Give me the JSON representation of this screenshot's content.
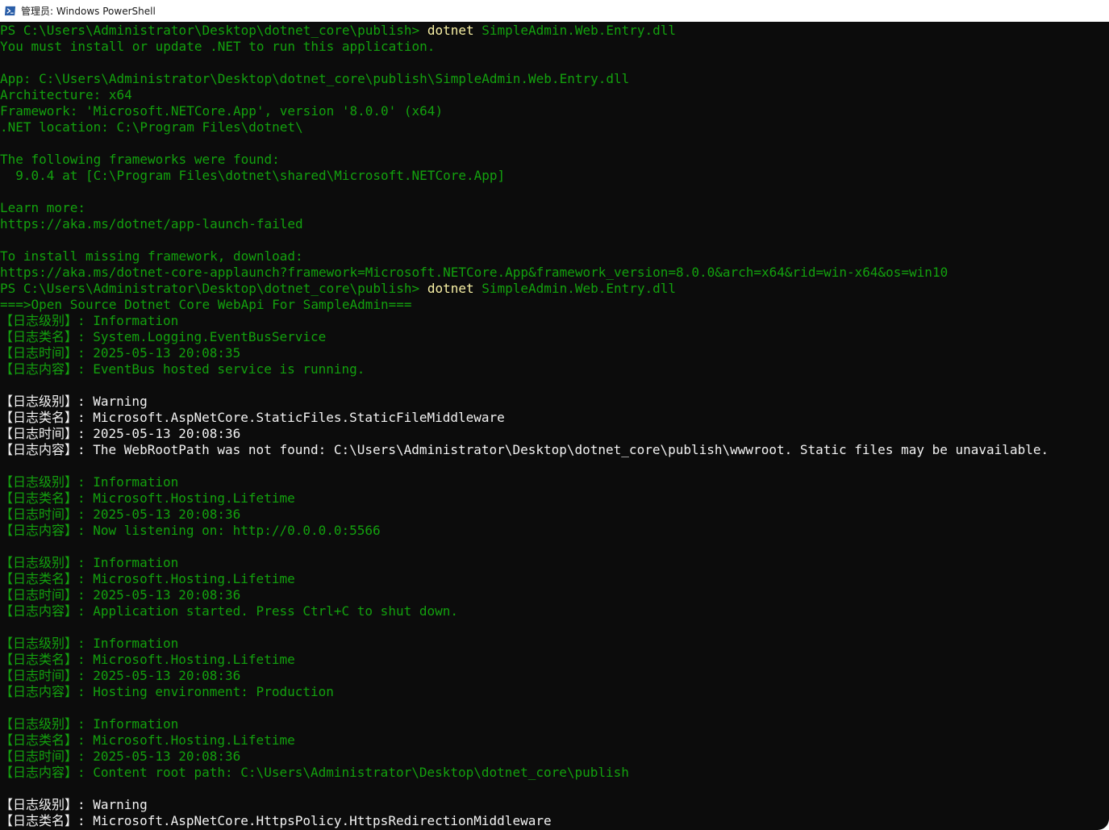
{
  "window": {
    "title": "管理员: Windows PowerShell",
    "icon": "powershell-icon"
  },
  "colors": {
    "background": "#0c0c0c",
    "green": "#13a10e",
    "white": "#f2f2f2",
    "command_yellow": "#f9f1a5",
    "title_bar": "#ffffff"
  },
  "console": {
    "lines": [
      {
        "color": "green",
        "parts": [
          {
            "t": "PS C:\\Users\\Administrator\\Desktop\\dotnet_core\\publish> "
          },
          {
            "t": "dotnet",
            "c": "cmd-kw"
          },
          {
            "t": " SimpleAdmin.Web.Entry.dll"
          }
        ]
      },
      {
        "color": "green",
        "parts": [
          {
            "t": "You must install or update .NET to run this application."
          }
        ]
      },
      {
        "color": "green",
        "parts": [
          {
            "t": ""
          }
        ]
      },
      {
        "color": "green",
        "parts": [
          {
            "t": "App: C:\\Users\\Administrator\\Desktop\\dotnet_core\\publish\\SimpleAdmin.Web.Entry.dll"
          }
        ]
      },
      {
        "color": "green",
        "parts": [
          {
            "t": "Architecture: x64"
          }
        ]
      },
      {
        "color": "green",
        "parts": [
          {
            "t": "Framework: 'Microsoft.NETCore.App', version '8.0.0' (x64)"
          }
        ]
      },
      {
        "color": "green",
        "parts": [
          {
            "t": ".NET location: C:\\Program Files\\dotnet\\"
          }
        ]
      },
      {
        "color": "green",
        "parts": [
          {
            "t": ""
          }
        ]
      },
      {
        "color": "green",
        "parts": [
          {
            "t": "The following frameworks were found:"
          }
        ]
      },
      {
        "color": "green",
        "parts": [
          {
            "t": "  9.0.4 at [C:\\Program Files\\dotnet\\shared\\Microsoft.NETCore.App]"
          }
        ]
      },
      {
        "color": "green",
        "parts": [
          {
            "t": ""
          }
        ]
      },
      {
        "color": "green",
        "parts": [
          {
            "t": "Learn more:"
          }
        ]
      },
      {
        "color": "green",
        "parts": [
          {
            "t": "https://aka.ms/dotnet/app-launch-failed"
          }
        ]
      },
      {
        "color": "green",
        "parts": [
          {
            "t": ""
          }
        ]
      },
      {
        "color": "green",
        "parts": [
          {
            "t": "To install missing framework, download:"
          }
        ]
      },
      {
        "color": "green",
        "parts": [
          {
            "t": "https://aka.ms/dotnet-core-applaunch?framework=Microsoft.NETCore.App&framework_version=8.0.0&arch=x64&rid=win-x64&os=win10"
          }
        ]
      },
      {
        "color": "green",
        "parts": [
          {
            "t": "PS C:\\Users\\Administrator\\Desktop\\dotnet_core\\publish> "
          },
          {
            "t": "dotnet",
            "c": "cmd-kw"
          },
          {
            "t": " SimpleAdmin.Web.Entry.dll"
          }
        ]
      },
      {
        "color": "green",
        "parts": [
          {
            "t": "===>Open Source Dotnet Core WebApi For SampleAdmin==="
          }
        ]
      },
      {
        "color": "green",
        "parts": [
          {
            "t": "【日志级别】: Information"
          }
        ]
      },
      {
        "color": "green",
        "parts": [
          {
            "t": "【日志类名】: System.Logging.EventBusService"
          }
        ]
      },
      {
        "color": "green",
        "parts": [
          {
            "t": "【日志时间】: 2025-05-13 20:08:35"
          }
        ]
      },
      {
        "color": "green",
        "parts": [
          {
            "t": "【日志内容】: EventBus hosted service is running."
          }
        ]
      },
      {
        "color": "green",
        "parts": [
          {
            "t": ""
          }
        ]
      },
      {
        "color": "white",
        "parts": [
          {
            "t": "【日志级别】: Warning"
          }
        ]
      },
      {
        "color": "white",
        "parts": [
          {
            "t": "【日志类名】: Microsoft.AspNetCore.StaticFiles.StaticFileMiddleware"
          }
        ]
      },
      {
        "color": "white",
        "parts": [
          {
            "t": "【日志时间】: 2025-05-13 20:08:36"
          }
        ]
      },
      {
        "color": "white",
        "parts": [
          {
            "t": "【日志内容】: The WebRootPath was not found: C:\\Users\\Administrator\\Desktop\\dotnet_core\\publish\\wwwroot. Static files may be unavailable."
          }
        ]
      },
      {
        "color": "green",
        "parts": [
          {
            "t": ""
          }
        ]
      },
      {
        "color": "green",
        "parts": [
          {
            "t": "【日志级别】: Information"
          }
        ]
      },
      {
        "color": "green",
        "parts": [
          {
            "t": "【日志类名】: Microsoft.Hosting.Lifetime"
          }
        ]
      },
      {
        "color": "green",
        "parts": [
          {
            "t": "【日志时间】: 2025-05-13 20:08:36"
          }
        ]
      },
      {
        "color": "green",
        "parts": [
          {
            "t": "【日志内容】: Now listening on: http://0.0.0.0:5566"
          }
        ]
      },
      {
        "color": "green",
        "parts": [
          {
            "t": ""
          }
        ]
      },
      {
        "color": "green",
        "parts": [
          {
            "t": "【日志级别】: Information"
          }
        ]
      },
      {
        "color": "green",
        "parts": [
          {
            "t": "【日志类名】: Microsoft.Hosting.Lifetime"
          }
        ]
      },
      {
        "color": "green",
        "parts": [
          {
            "t": "【日志时间】: 2025-05-13 20:08:36"
          }
        ]
      },
      {
        "color": "green",
        "parts": [
          {
            "t": "【日志内容】: Application started. Press Ctrl+C to shut down."
          }
        ]
      },
      {
        "color": "green",
        "parts": [
          {
            "t": ""
          }
        ]
      },
      {
        "color": "green",
        "parts": [
          {
            "t": "【日志级别】: Information"
          }
        ]
      },
      {
        "color": "green",
        "parts": [
          {
            "t": "【日志类名】: Microsoft.Hosting.Lifetime"
          }
        ]
      },
      {
        "color": "green",
        "parts": [
          {
            "t": "【日志时间】: 2025-05-13 20:08:36"
          }
        ]
      },
      {
        "color": "green",
        "parts": [
          {
            "t": "【日志内容】: Hosting environment: Production"
          }
        ]
      },
      {
        "color": "green",
        "parts": [
          {
            "t": ""
          }
        ]
      },
      {
        "color": "green",
        "parts": [
          {
            "t": "【日志级别】: Information"
          }
        ]
      },
      {
        "color": "green",
        "parts": [
          {
            "t": "【日志类名】: Microsoft.Hosting.Lifetime"
          }
        ]
      },
      {
        "color": "green",
        "parts": [
          {
            "t": "【日志时间】: 2025-05-13 20:08:36"
          }
        ]
      },
      {
        "color": "green",
        "parts": [
          {
            "t": "【日志内容】: Content root path: C:\\Users\\Administrator\\Desktop\\dotnet_core\\publish"
          }
        ]
      },
      {
        "color": "green",
        "parts": [
          {
            "t": ""
          }
        ]
      },
      {
        "color": "white",
        "parts": [
          {
            "t": "【日志级别】: Warning"
          }
        ]
      },
      {
        "color": "white",
        "parts": [
          {
            "t": "【日志类名】: Microsoft.AspNetCore.HttpsPolicy.HttpsRedirectionMiddleware"
          }
        ]
      }
    ]
  }
}
